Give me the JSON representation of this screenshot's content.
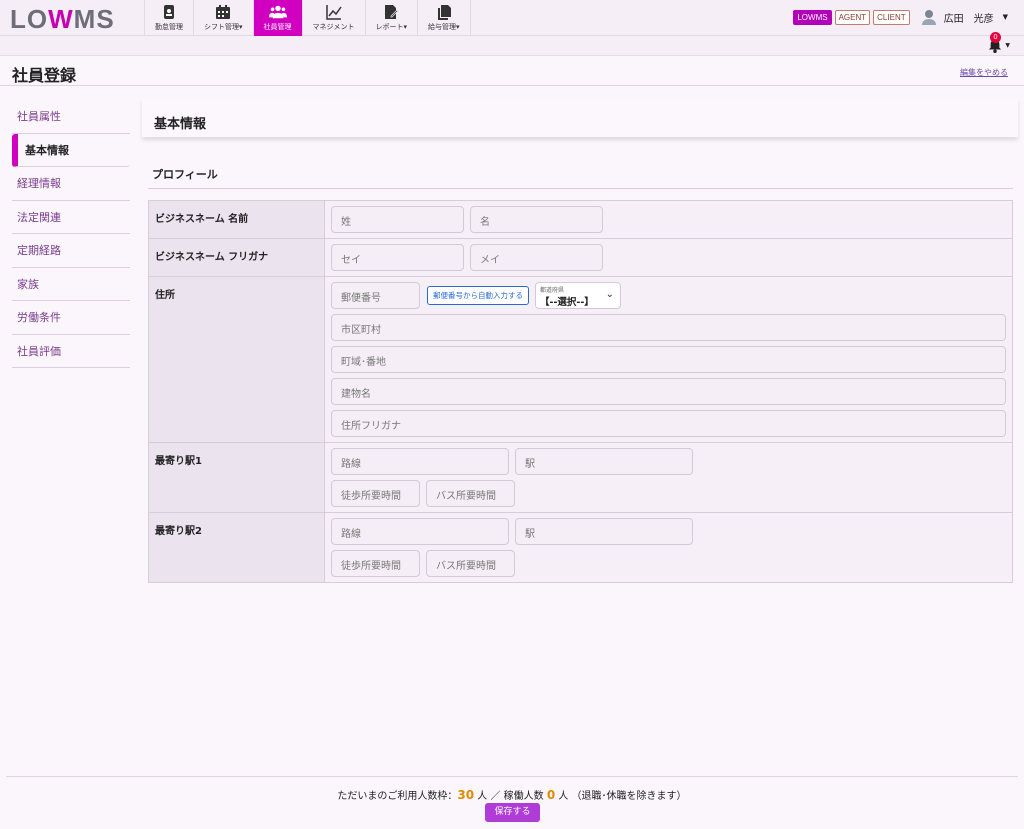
{
  "brand": {
    "logo_part1": "LO",
    "logo_part2": "W",
    "logo_part3": "MS"
  },
  "nav": [
    {
      "label": "勤怠管理",
      "icon": "id-badge-icon",
      "active": false
    },
    {
      "label": "シフト管理▾",
      "icon": "calendar-icon",
      "active": false
    },
    {
      "label": "社員管理",
      "icon": "users-icon",
      "active": true
    },
    {
      "label": "マネジメント",
      "icon": "chart-line-icon",
      "active": false
    },
    {
      "label": "レポート▾",
      "icon": "report-edit-icon",
      "active": false
    },
    {
      "label": "給与管理▾",
      "icon": "documents-icon",
      "active": false
    }
  ],
  "roles": [
    "LOWMS",
    "AGENT",
    "CLIENT"
  ],
  "user": {
    "name": "広田　光彦"
  },
  "notifications": {
    "count": "0"
  },
  "page": {
    "title": "社員登録",
    "stop_edit": "編集をやめる"
  },
  "sidebar": [
    {
      "label": "社員属性",
      "active": false
    },
    {
      "label": "基本情報",
      "active": true
    },
    {
      "label": "経理情報",
      "active": false
    },
    {
      "label": "法定関連",
      "active": false
    },
    {
      "label": "定期経路",
      "active": false
    },
    {
      "label": "家族",
      "active": false
    },
    {
      "label": "労働条件",
      "active": false
    },
    {
      "label": "社員評価",
      "active": false
    }
  ],
  "section": {
    "title": "基本情報",
    "profile": "プロフィール"
  },
  "form": {
    "business_name": {
      "label": "ビジネスネーム 名前",
      "last": "姓",
      "first": "名"
    },
    "business_kana": {
      "label": "ビジネスネーム フリガナ",
      "last": "セイ",
      "first": "メイ"
    },
    "address": {
      "label": "住所",
      "zip": "郵便番号",
      "zip_button": "郵便番号から自動入力する",
      "pref_caption": "都道府県",
      "pref_value": "【--選択--】",
      "city": "市区町村",
      "street": "町域･番地",
      "building": "建物名",
      "kana": "住所フリガナ"
    },
    "station1": {
      "label": "最寄り駅1",
      "line": "路線",
      "station": "駅",
      "walk": "徒歩所要時間",
      "bus": "バス所要時間"
    },
    "station2": {
      "label": "最寄り駅2",
      "line": "路線",
      "station": "駅",
      "walk": "徒歩所要時間",
      "bus": "バス所要時間"
    }
  },
  "footer": {
    "prefix": "ただいまのご利用人数枠：",
    "capacity": "30",
    "mid": " 人 ／ 稼働人数 ",
    "active_count": "0",
    "suffix": " 人 （退職･休職を除きます）",
    "save": "保存する"
  }
}
